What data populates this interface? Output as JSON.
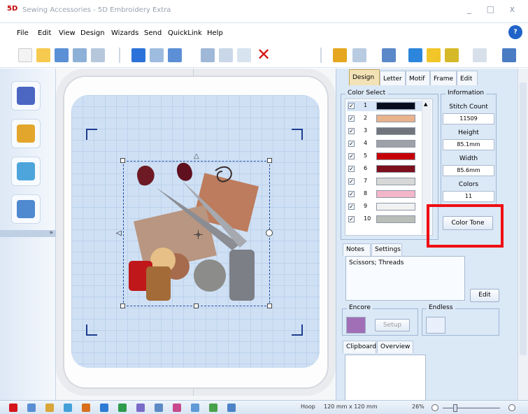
{
  "window": {
    "app_icon_text": "5D",
    "title": "Sewing Accessories - 5D Embroidery Extra",
    "controls": [
      "_",
      "□",
      "x"
    ]
  },
  "menu": {
    "items": [
      "File",
      "Edit",
      "View",
      "Design",
      "Wizards",
      "Send",
      "QuickLink",
      "Help"
    ],
    "help_icon": "?"
  },
  "toolbar": {
    "icons": [
      "new-icon",
      "open-icon",
      "save-icon",
      "find-icon",
      "stitch-icon",
      "undo-icon",
      "redo-icon",
      "view-icon",
      "cut-icon",
      "copy-icon",
      "paste-icon",
      "delete-icon",
      "select-icon",
      "zoom-icon",
      "move-icon",
      "pencil-icon",
      "3d-icon",
      "layout-icon",
      "hoop-icon"
    ]
  },
  "left_panel": {
    "tools": [
      "lettering-icon",
      "quick-create-icon",
      "split-design-icon",
      "shape-design-icon"
    ],
    "collapse": "»"
  },
  "right_panel": {
    "tabs": [
      "Design",
      "Letter",
      "Motif",
      "Frame",
      "Edit"
    ],
    "color_select": {
      "title": "Color Select",
      "rows": [
        {
          "num": "1",
          "color": "#060b1d",
          "checked": true
        },
        {
          "num": "2",
          "color": "#e9b38c",
          "checked": true
        },
        {
          "num": "3",
          "color": "#70757d",
          "checked": true
        },
        {
          "num": "4",
          "color": "#9ea2a8",
          "checked": true
        },
        {
          "num": "5",
          "color": "#c60008",
          "checked": true
        },
        {
          "num": "6",
          "color": "#7d0f1d",
          "checked": true
        },
        {
          "num": "7",
          "color": "#d7d7d7",
          "checked": true
        },
        {
          "num": "8",
          "color": "#f4b6c9",
          "checked": true
        },
        {
          "num": "9",
          "color": "#f2f2f2",
          "checked": true
        },
        {
          "num": "10",
          "color": "#babdb8",
          "checked": true
        }
      ]
    },
    "information": {
      "title": "Information",
      "stitch_count_label": "Stitch Count",
      "stitch_count": "11509",
      "height_label": "Height",
      "height": "85.1mm",
      "width_label": "Width",
      "width": "85.6mm",
      "colors_label": "Colors",
      "colors": "11"
    },
    "color_tone_button": "Color Tone",
    "notes_tabs": [
      "Notes",
      "Settings"
    ],
    "notes_text": "Scissors; Threads",
    "edit_button": "Edit",
    "encore_label": "Encore",
    "endless_label": "Endless",
    "encore_disabled_button": "Setup",
    "clipboard_tabs": [
      "Clipboard",
      "Overview"
    ]
  },
  "statusbar": {
    "hoop_label": "Hoop",
    "hoop_size": "120 mm x 120 mm",
    "zoom": "26%"
  }
}
